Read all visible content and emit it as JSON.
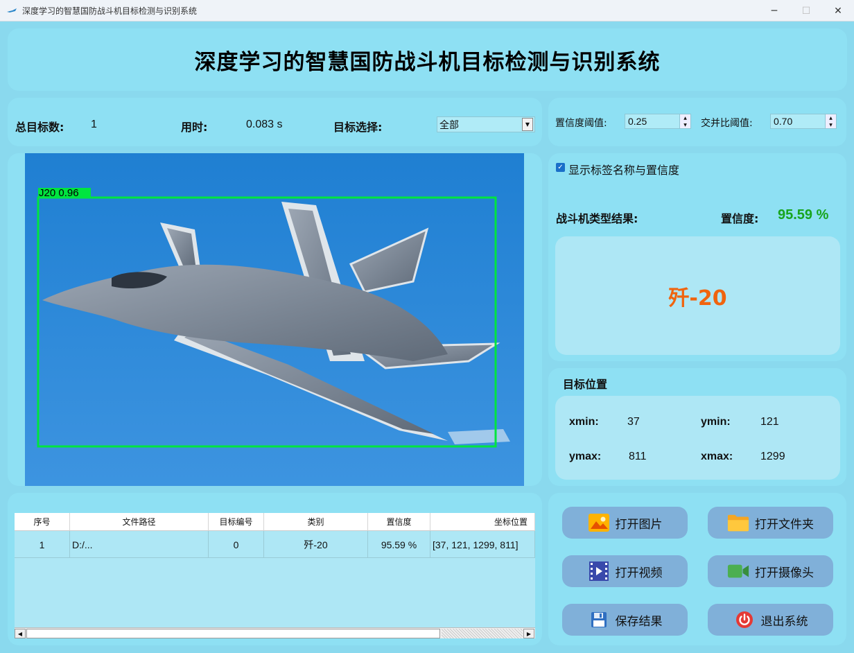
{
  "window": {
    "title": "深度学习的智慧国防战斗机目标检测与识别系统",
    "min": "─",
    "max": "☐",
    "close": "✕"
  },
  "header": {
    "title": "深度学习的智慧国防战斗机目标检测与识别系统"
  },
  "stats": {
    "total_label": "总目标数:",
    "total_value": "1",
    "time_label": "用时:",
    "time_value": "0.083 s",
    "target_label": "目标选择:",
    "target_value": "全部"
  },
  "thresholds": {
    "conf_label": "置信度阈值:",
    "conf_value": "0.25",
    "iou_label": "交并比阈值:",
    "iou_value": "0.70"
  },
  "detection": {
    "box_label": "J20  0.96",
    "box_color": "#00e53f"
  },
  "result": {
    "show_labels_text": "显示标签名称与置信度",
    "show_labels_checked": true,
    "type_label": "战斗机类型结果:",
    "conf_label": "置信度:",
    "conf_value": "95.59 %",
    "type_value": "歼-20"
  },
  "position": {
    "title": "目标位置",
    "xmin_label": "xmin:",
    "xmin_value": "37",
    "ymin_label": "ymin:",
    "ymin_value": "121",
    "ymax_label": "ymax:",
    "ymax_value": "811",
    "xmax_label": "xmax:",
    "xmax_value": "1299"
  },
  "table": {
    "headers": [
      "序号",
      "文件路径",
      "目标编号",
      "类别",
      "置信度",
      "坐标位置"
    ],
    "rows": [
      [
        "1",
        "D:/...",
        "0",
        "歼-20",
        "95.59 %",
        "[37, 121, 1299, 811]"
      ]
    ]
  },
  "buttons": {
    "open_image": "打开图片",
    "open_folder": "打开文件夹",
    "open_video": "打开视频",
    "open_camera": "打开摄像头",
    "save_result": "保存结果",
    "exit": "退出系统"
  },
  "colors": {
    "accent_conf": "#17a51d",
    "accent_type": "#f0640e",
    "panel": "#8ee0f3",
    "button": "#80b0d9"
  }
}
